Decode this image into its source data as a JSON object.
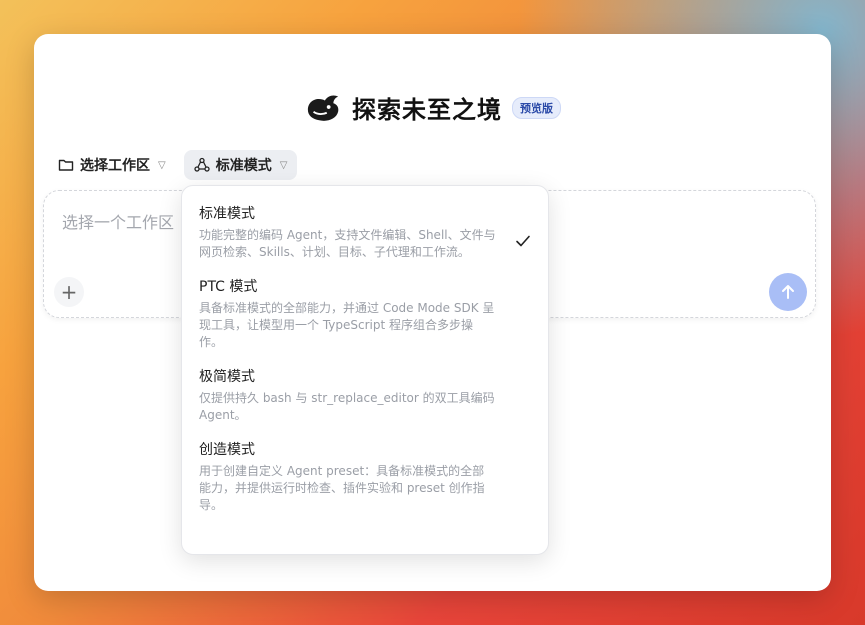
{
  "brand": {
    "title": "探索未至之境",
    "badge": "预览版",
    "logo_icon": "whale-icon"
  },
  "toolbar": {
    "workspace_label": "选择工作区",
    "mode_label": "标准模式"
  },
  "composer": {
    "placeholder": "选择一个工作区",
    "add_icon": "plus-icon",
    "send_icon": "arrow-up-icon"
  },
  "dropdown": {
    "items": [
      {
        "title": "标准模式",
        "desc": "功能完整的编码 Agent，支持文件编辑、Shell、文件与网页检索、Skills、计划、目标、子代理和工作流。",
        "selected": true
      },
      {
        "title": "PTC 模式",
        "desc": "具备标准模式的全部能力，并通过 Code Mode SDK 呈现工具，让模型用一个 TypeScript 程序组合多步操作。",
        "selected": false
      },
      {
        "title": "极简模式",
        "desc": "仅提供持久 bash 与 str_replace_editor 的双工具编码 Agent。",
        "selected": false
      },
      {
        "title": "创造模式",
        "desc": "用于创建自定义 Agent preset：具备标准模式的全部能力，并提供运行时检查、插件实验和 preset 创作指导。",
        "selected": false
      }
    ]
  },
  "colors": {
    "accent": "#a9bef6",
    "badge_text": "#2b4aa8"
  }
}
